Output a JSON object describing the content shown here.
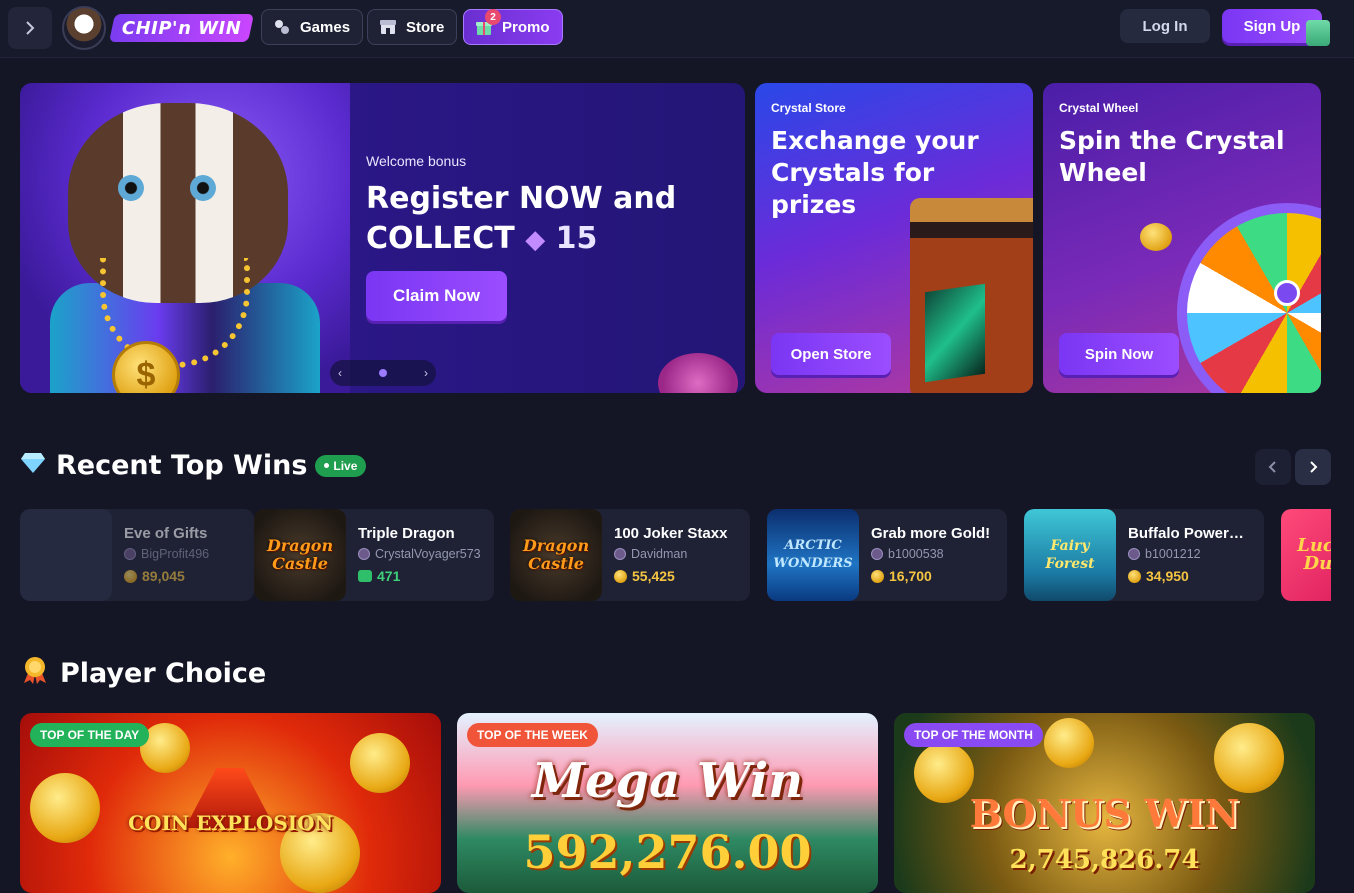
{
  "header": {
    "brand": "CHIP'n WIN",
    "nav": [
      {
        "label": "Games",
        "icon": "dice-icon"
      },
      {
        "label": "Store",
        "icon": "store-icon"
      },
      {
        "label": "Promo",
        "icon": "gift-icon",
        "badge": "2"
      }
    ],
    "login_label": "Log In",
    "signup_label": "Sign Up"
  },
  "hero": {
    "kicker": "Welcome bonus",
    "title_line1": "Register NOW and",
    "title_line2": "COLLECT",
    "gem_amount": "15",
    "cta": "Claim Now",
    "slider_prev": "‹",
    "slider_next": "›"
  },
  "store_card": {
    "kicker": "Crystal Store",
    "title": "Exchange your Crystals for prizes",
    "cta": "Open Store"
  },
  "wheel_card": {
    "kicker": "Crystal Wheel",
    "title": "Spin the Crystal Wheel",
    "cta": "Spin Now"
  },
  "recent_wins": {
    "title": "Recent Top Wins",
    "live_label": "Live",
    "items": [
      {
        "game": "Eve of Gifts",
        "user": "BigProfit496",
        "amount": "89,045",
        "currency": "coin",
        "thumb": ""
      },
      {
        "game": "Triple Dragon",
        "user": "CrystalVoyager573",
        "amount": "471",
        "currency": "cash",
        "thumb": "Dragon Castle"
      },
      {
        "game": "100 Joker Staxx",
        "user": "Davidman",
        "amount": "55,425",
        "currency": "coin",
        "thumb": "Dragon Castle"
      },
      {
        "game": "Grab more Gold!",
        "user": "b1000538",
        "amount": "16,700",
        "currency": "coin",
        "thumb": "ARCTIC WONDERS"
      },
      {
        "game": "Buffalo Power…",
        "user": "b1001212",
        "amount": "34,950",
        "currency": "coin",
        "thumb": "Fairy Forest"
      },
      {
        "game": "",
        "user": "",
        "amount": "",
        "currency": "coin",
        "thumb": "Lucky Duel"
      }
    ]
  },
  "player_choice": {
    "title": "Player Choice",
    "cards": [
      {
        "tag": "TOP OF THE DAY",
        "caption": "COIN EXPLOSION",
        "amount": ""
      },
      {
        "tag": "TOP OF THE WEEK",
        "caption": "Mega Win",
        "amount": "592,276.00"
      },
      {
        "tag": "TOP OF THE MONTH",
        "caption": "BONUS WIN",
        "amount": "2,745,826.74"
      }
    ]
  },
  "colors": {
    "background": "#141626",
    "accent": "#8a3cf0",
    "live": "#1e9e4e",
    "coin": "#f5c542"
  }
}
